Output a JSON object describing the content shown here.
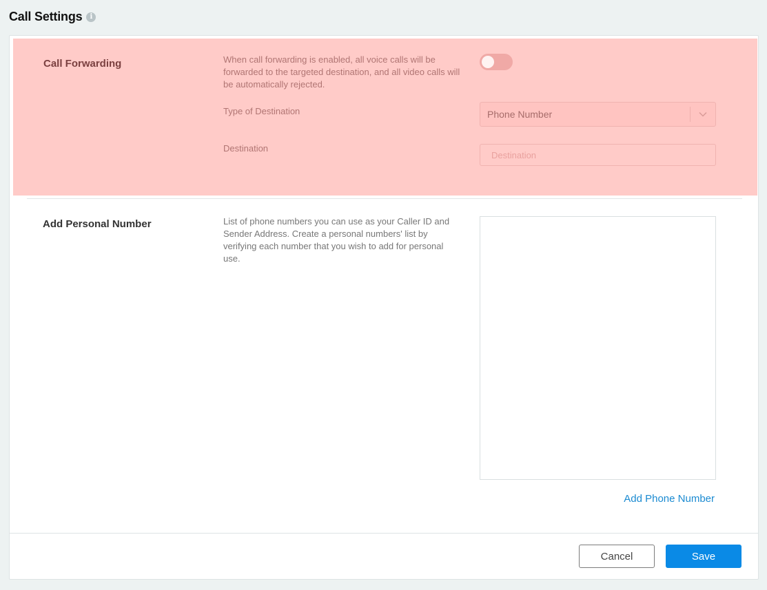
{
  "header": {
    "title": "Call Settings",
    "info_icon": "info-icon"
  },
  "call_forwarding": {
    "label": "Call Forwarding",
    "description": "When call forwarding is enabled, all voice calls will be forwarded to the targeted destination, and all video calls will be automatically rejected.",
    "toggle_on": false,
    "type_label": "Type of Destination",
    "type_value": "Phone Number",
    "destination_label": "Destination",
    "destination_placeholder": "Destination",
    "destination_value": ""
  },
  "personal_number": {
    "label": "Add Personal Number",
    "description": "List of phone numbers you can use as your Caller ID and Sender Address. Create a personal numbers' list by verifying each number that you wish to add for personal use.",
    "numbers": [],
    "add_link": "Add Phone Number"
  },
  "footer": {
    "cancel_label": "Cancel",
    "save_label": "Save"
  },
  "colors": {
    "accent": "#0a8ae6",
    "link": "#1a8ad1",
    "highlight": "#ffcbc8"
  }
}
